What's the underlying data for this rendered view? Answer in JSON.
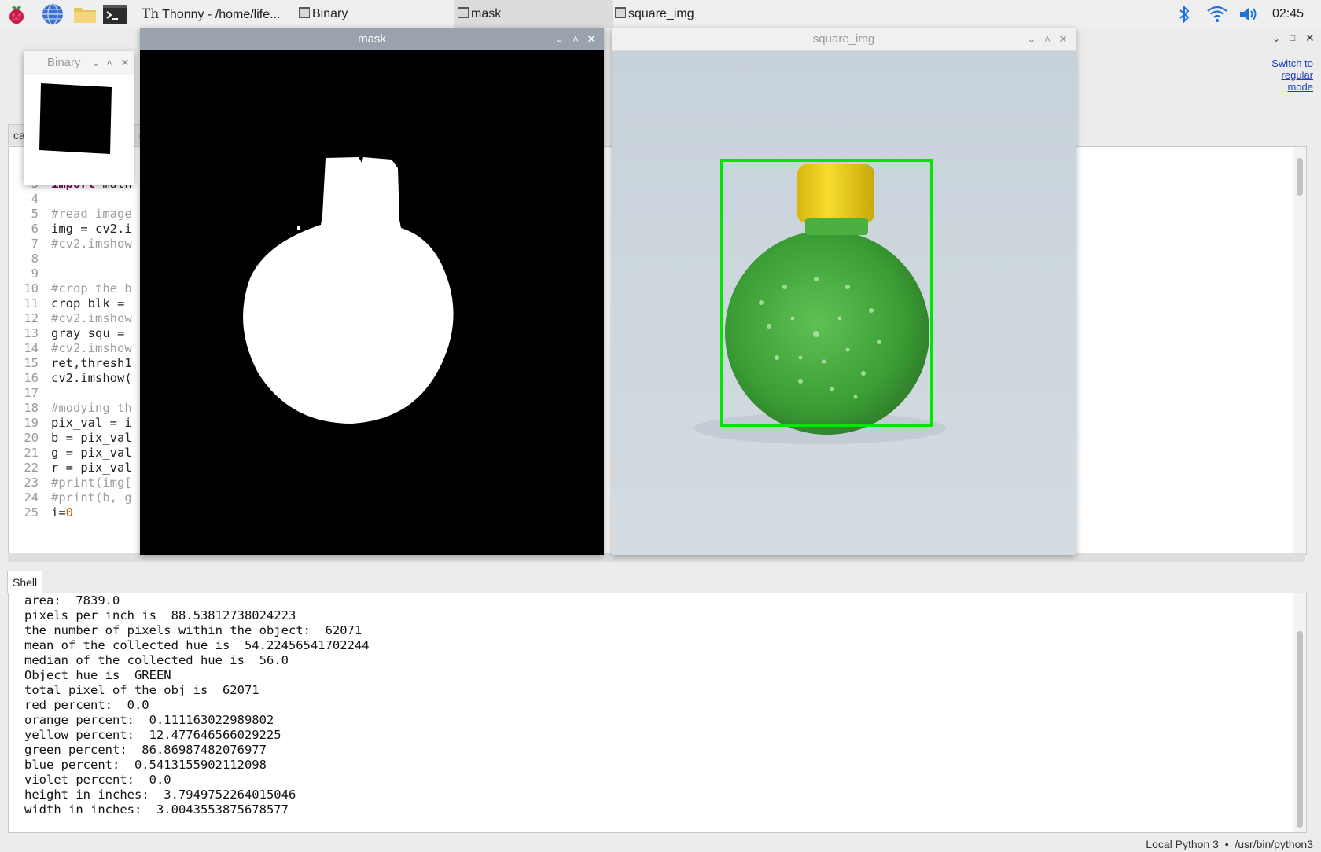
{
  "taskbar": {
    "launchers": [
      "raspberry-menu-icon",
      "browser-icon",
      "file-manager-icon",
      "terminal-icon"
    ],
    "tasks": [
      {
        "label": "Thonny  -  /home/life..."
      },
      {
        "label": "Binary"
      },
      {
        "label": "mask"
      },
      {
        "label": "square_img"
      }
    ],
    "clock": "02:45",
    "tray": [
      "bluetooth-icon",
      "wifi-icon",
      "volume-icon"
    ]
  },
  "thonny": {
    "switch_mode": "Switch to\nregular\nmode",
    "editor_tab": "ca",
    "editor_tab2": "o",
    "editor_lines": [
      {
        "n": "3",
        "segments": [
          {
            "t": "import",
            "c": "kw"
          },
          {
            "t": " math",
            "c": ""
          }
        ]
      },
      {
        "n": "4",
        "segments": []
      },
      {
        "n": "5",
        "segments": [
          {
            "t": "#read image",
            "c": "cm"
          }
        ]
      },
      {
        "n": "6",
        "segments": [
          {
            "t": "img = cv2.i",
            "c": ""
          }
        ]
      },
      {
        "n": "7",
        "segments": [
          {
            "t": "#cv2.imshow",
            "c": "cm"
          }
        ]
      },
      {
        "n": "8",
        "segments": []
      },
      {
        "n": "9",
        "segments": []
      },
      {
        "n": "10",
        "segments": [
          {
            "t": "#crop the b",
            "c": "cm"
          }
        ]
      },
      {
        "n": "11",
        "segments": [
          {
            "t": "crop_blk = ",
            "c": ""
          }
        ]
      },
      {
        "n": "12",
        "segments": [
          {
            "t": "#cv2.imshow",
            "c": "cm"
          }
        ]
      },
      {
        "n": "13",
        "segments": [
          {
            "t": "gray_squ = ",
            "c": ""
          }
        ]
      },
      {
        "n": "14",
        "segments": [
          {
            "t": "#cv2.imshow",
            "c": "cm"
          }
        ]
      },
      {
        "n": "15",
        "segments": [
          {
            "t": "ret,thresh1",
            "c": ""
          }
        ]
      },
      {
        "n": "16",
        "segments": [
          {
            "t": "cv2.imshow(",
            "c": ""
          }
        ]
      },
      {
        "n": "17",
        "segments": []
      },
      {
        "n": "18",
        "segments": [
          {
            "t": "#modying th",
            "c": "cm"
          }
        ]
      },
      {
        "n": "19",
        "segments": [
          {
            "t": "pix_val = i",
            "c": ""
          }
        ]
      },
      {
        "n": "20",
        "segments": [
          {
            "t": "b = pix_val",
            "c": ""
          }
        ]
      },
      {
        "n": "21",
        "segments": [
          {
            "t": "g = pix_val",
            "c": ""
          }
        ]
      },
      {
        "n": "22",
        "segments": [
          {
            "t": "r = pix_val",
            "c": ""
          }
        ]
      },
      {
        "n": "23",
        "segments": [
          {
            "t": "#print(img[",
            "c": "cm"
          }
        ]
      },
      {
        "n": "24",
        "segments": [
          {
            "t": "#print(b, g",
            "c": "cm"
          }
        ]
      },
      {
        "n": "25",
        "segments": [
          {
            "t": "i=",
            "c": ""
          },
          {
            "t": "0",
            "c": "num"
          }
        ]
      }
    ],
    "shell_tab": "Shell",
    "shell_lines": [
      "area:  7839.0",
      "pixels per inch is  88.53812738024223",
      "the number of pixels within the object:  62071",
      "mean of the collected hue is  54.22456541702244",
      "median of the collected hue is  56.0",
      "Object hue is  GREEN",
      "total pixel of the obj is  62071",
      "red percent:  0.0",
      "orange percent:  0.111163022989802",
      "yellow percent:  12.477646566029225",
      "green percent:  86.86987482076977",
      "blue percent:  0.5413155902112098",
      "violet percent:  0.0",
      "height in inches:  3.7949752264015046",
      "width in inches:  3.0043553875678577"
    ],
    "status": "Local Python 3  •  /usr/bin/python3"
  },
  "windows": {
    "binary": {
      "title": "Binary"
    },
    "mask": {
      "title": "mask"
    },
    "square_img": {
      "title": "square_img"
    }
  },
  "colors": {
    "bbox": "#00e600",
    "bottle_green": "#3fa63a",
    "cap_yellow": "#f2d21a",
    "title_bar": "#9aa3ad"
  }
}
